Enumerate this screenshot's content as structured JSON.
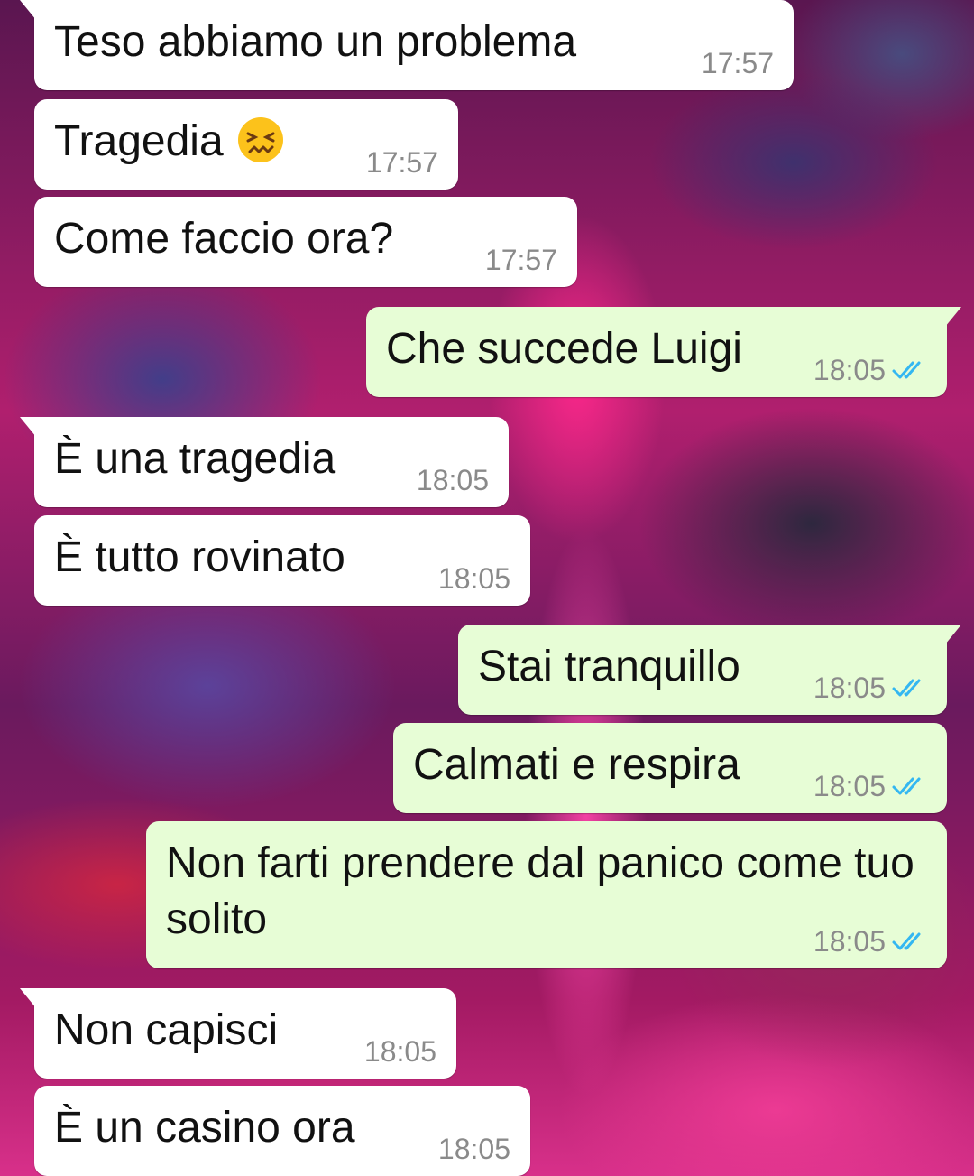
{
  "chat": {
    "messages": [
      {
        "id": "m1",
        "direction": "incoming",
        "text": "Teso abbiamo un problema",
        "time": "17:57"
      },
      {
        "id": "m2",
        "direction": "incoming",
        "text": "Tragedia",
        "emoji": "confounded-face",
        "time": "17:57"
      },
      {
        "id": "m3",
        "direction": "incoming",
        "text": "Come faccio ora?",
        "time": "17:57"
      },
      {
        "id": "m4",
        "direction": "outgoing",
        "text": "Che succede Luigi",
        "time": "18:05",
        "status": "read"
      },
      {
        "id": "m5",
        "direction": "incoming",
        "text": "È una tragedia",
        "time": "18:05"
      },
      {
        "id": "m6",
        "direction": "incoming",
        "text": "È tutto rovinato",
        "time": "18:05"
      },
      {
        "id": "m7",
        "direction": "outgoing",
        "text": "Stai tranquillo",
        "time": "18:05",
        "status": "read"
      },
      {
        "id": "m8",
        "direction": "outgoing",
        "text": "Calmati e respira",
        "time": "18:05",
        "status": "read"
      },
      {
        "id": "m9",
        "direction": "outgoing",
        "text": "Non farti prendere dal panico come tuo solito",
        "time": "18:05",
        "status": "read"
      },
      {
        "id": "m10",
        "direction": "incoming",
        "text": "Non capisci",
        "time": "18:05"
      },
      {
        "id": "m11",
        "direction": "incoming",
        "text": "È un casino ora",
        "time": "18:05"
      }
    ]
  },
  "colors": {
    "incoming_bubble": "#ffffff",
    "outgoing_bubble": "#e7fdd6",
    "read_ticks": "#34b7f1",
    "timestamp": "#8a8a8a"
  },
  "icons": {
    "read_receipt": "double-check-icon",
    "emoji": "confounded-face-emoji"
  }
}
